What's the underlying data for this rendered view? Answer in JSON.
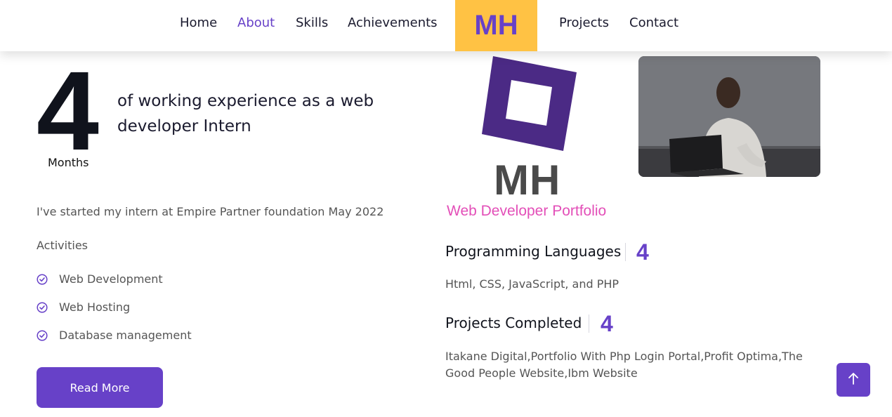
{
  "nav": {
    "items": [
      {
        "label": "Home",
        "active": false
      },
      {
        "label": "About",
        "active": true
      },
      {
        "label": "Skills",
        "active": false
      },
      {
        "label": "Achievements",
        "active": false
      },
      {
        "label": "Projects",
        "active": false
      },
      {
        "label": "Contact",
        "active": false
      }
    ],
    "brand": "MH"
  },
  "experience": {
    "number": "4",
    "unit": "Months",
    "text": "of working experience as a web developer Intern"
  },
  "about": {
    "intro": "I've started my intern at Empire Partner foundation May 2022",
    "activities_label": "Activities",
    "activities": [
      "Web Development",
      "Web Hosting",
      "Database management"
    ],
    "read_more": "Read More"
  },
  "logo": {
    "text": "MH",
    "tagline": "Web Developer Portfolio"
  },
  "stats": [
    {
      "title": "Programming Languages",
      "value": "4",
      "description": "Html, CSS, JavaScript, and PHP"
    },
    {
      "title": "Projects Completed",
      "value": "4",
      "description": "Itakane Digital,Portfolio With Php Login Portal,Profit Optima,The Good People Website,Ibm Website"
    }
  ],
  "colors": {
    "accent": "#6741c8",
    "brand_bg": "#ffc244",
    "tagline": "#e34fb8"
  },
  "icons": {
    "activity": "check-circle-icon",
    "scroll_top": "arrow-up-icon"
  }
}
